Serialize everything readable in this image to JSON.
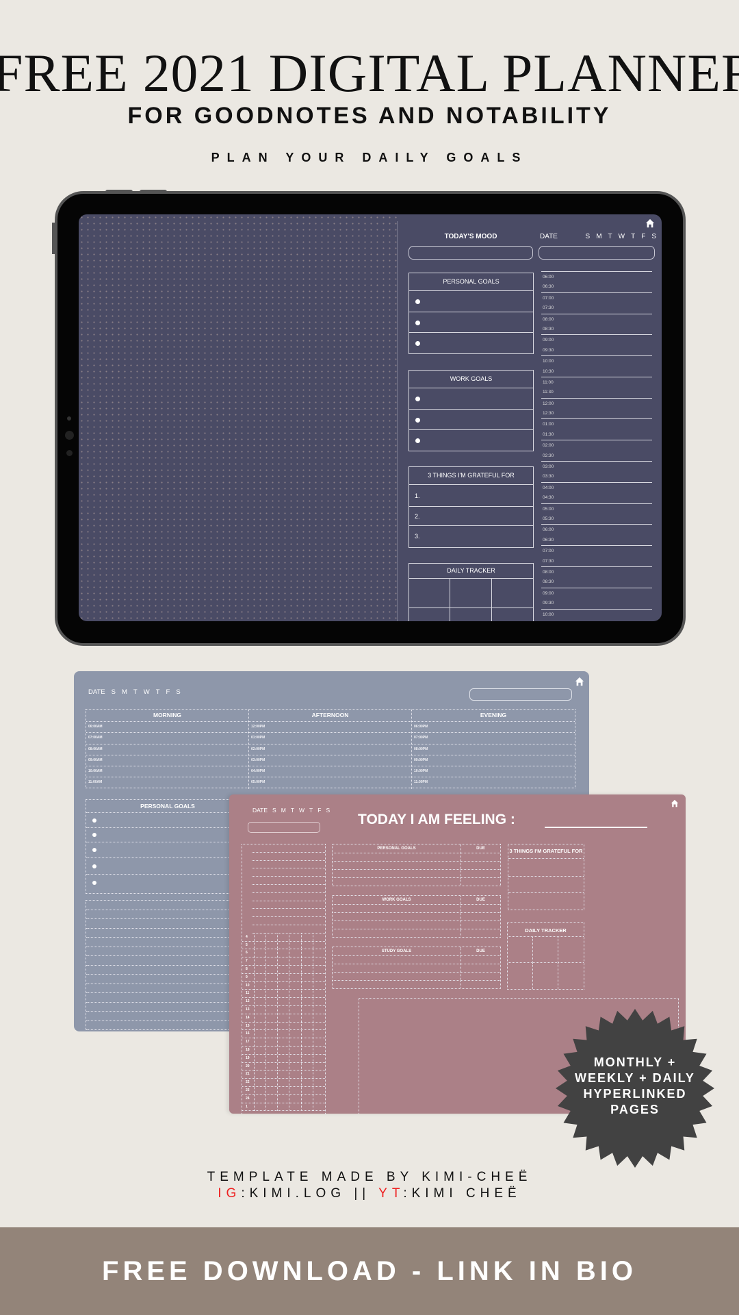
{
  "header": {
    "title": "FREE 2021 DIGITAL PLANNER",
    "subtitle": "FOR GOODNOTES AND NOTABILITY",
    "tagline": "PLAN YOUR DAILY GOALS"
  },
  "colors": {
    "background": "#ebe8e2",
    "dark_page": "#4a4b65",
    "blue_page": "#8e97aa",
    "pink_page": "#ab8087",
    "badge": "#424242",
    "footer": "#938479",
    "accent_red": "#e22222"
  },
  "dark_planner": {
    "mood_label": "TODAY'S MOOD",
    "date_label": "DATE",
    "days": [
      "S",
      "M",
      "T",
      "W",
      "T",
      "F",
      "S"
    ],
    "personal_goals": "PERSONAL GOALS",
    "work_goals": "WORK GOALS",
    "grateful": "3 THINGS I'M GRATEFUL FOR",
    "grateful_items": [
      "1.",
      "2.",
      "3."
    ],
    "tracker": "DAILY TRACKER",
    "times": [
      "06:00",
      "06:30",
      "07:00",
      "07:30",
      "08:00",
      "08:30",
      "09:00",
      "09:30",
      "10:00",
      "10:30",
      "11:00",
      "11:30",
      "12:00",
      "12:30",
      "01:00",
      "01:30",
      "02:00",
      "02:30",
      "03:00",
      "03:30",
      "04:00",
      "04:30",
      "05:00",
      "05:30",
      "06:00",
      "06:30",
      "07:00",
      "07:30",
      "08:00",
      "08:30",
      "09:00",
      "09:30",
      "10:00"
    ],
    "icon": "home-icon"
  },
  "blue_planner": {
    "date_label": "DATE",
    "days": [
      "S",
      "M",
      "T",
      "W",
      "T",
      "F",
      "S"
    ],
    "columns": [
      {
        "title": "MORNING",
        "times": [
          "06:00AM",
          "07:00AM",
          "08:00AM",
          "09:00AM",
          "10:00AM",
          "11:00AM"
        ]
      },
      {
        "title": "AFTERNOON",
        "times": [
          "12:00PM",
          "01:00PM",
          "02:00PM",
          "03:00PM",
          "04:00PM",
          "05:00PM"
        ]
      },
      {
        "title": "EVENING",
        "times": [
          "06:00PM",
          "07:00PM",
          "08:00PM",
          "09:00PM",
          "10:00PM",
          "11:00PM"
        ]
      }
    ],
    "personal_goals": "PERSONAL GOALS"
  },
  "pink_planner": {
    "date_label": "DATE",
    "days": [
      "S",
      "M",
      "T",
      "W",
      "T",
      "F",
      "S"
    ],
    "feeling": "TODAY I AM FEELING :",
    "goal_boxes": [
      {
        "title": "PERSONAL GOALS",
        "due": "DUE"
      },
      {
        "title": "WORK GOALS",
        "due": "DUE"
      },
      {
        "title": "STUDY GOALS",
        "due": "DUE"
      }
    ],
    "grateful": "3 THINGS I'M GRATEFUL FOR",
    "tracker": "DAILY TRACKER",
    "numbers": [
      "4",
      "5",
      "6",
      "7",
      "8",
      "9",
      "10",
      "11",
      "12",
      "13",
      "14",
      "15",
      "16",
      "17",
      "18",
      "19",
      "20",
      "21",
      "22",
      "23",
      "24",
      "1"
    ]
  },
  "badge": {
    "lines": [
      "MONTHLY +",
      "WEEKLY + DAILY",
      "HYPERLINKED",
      "PAGES"
    ]
  },
  "credits": {
    "line1": "TEMPLATE MADE BY KIMI-CHEË",
    "ig_label": "IG",
    "ig_handle": ":KIMI.LOG ||",
    "yt_label": "YT",
    "yt_handle": ":KIMI CHEË"
  },
  "footer": {
    "text": "FREE DOWNLOAD - LINK IN BIO"
  }
}
